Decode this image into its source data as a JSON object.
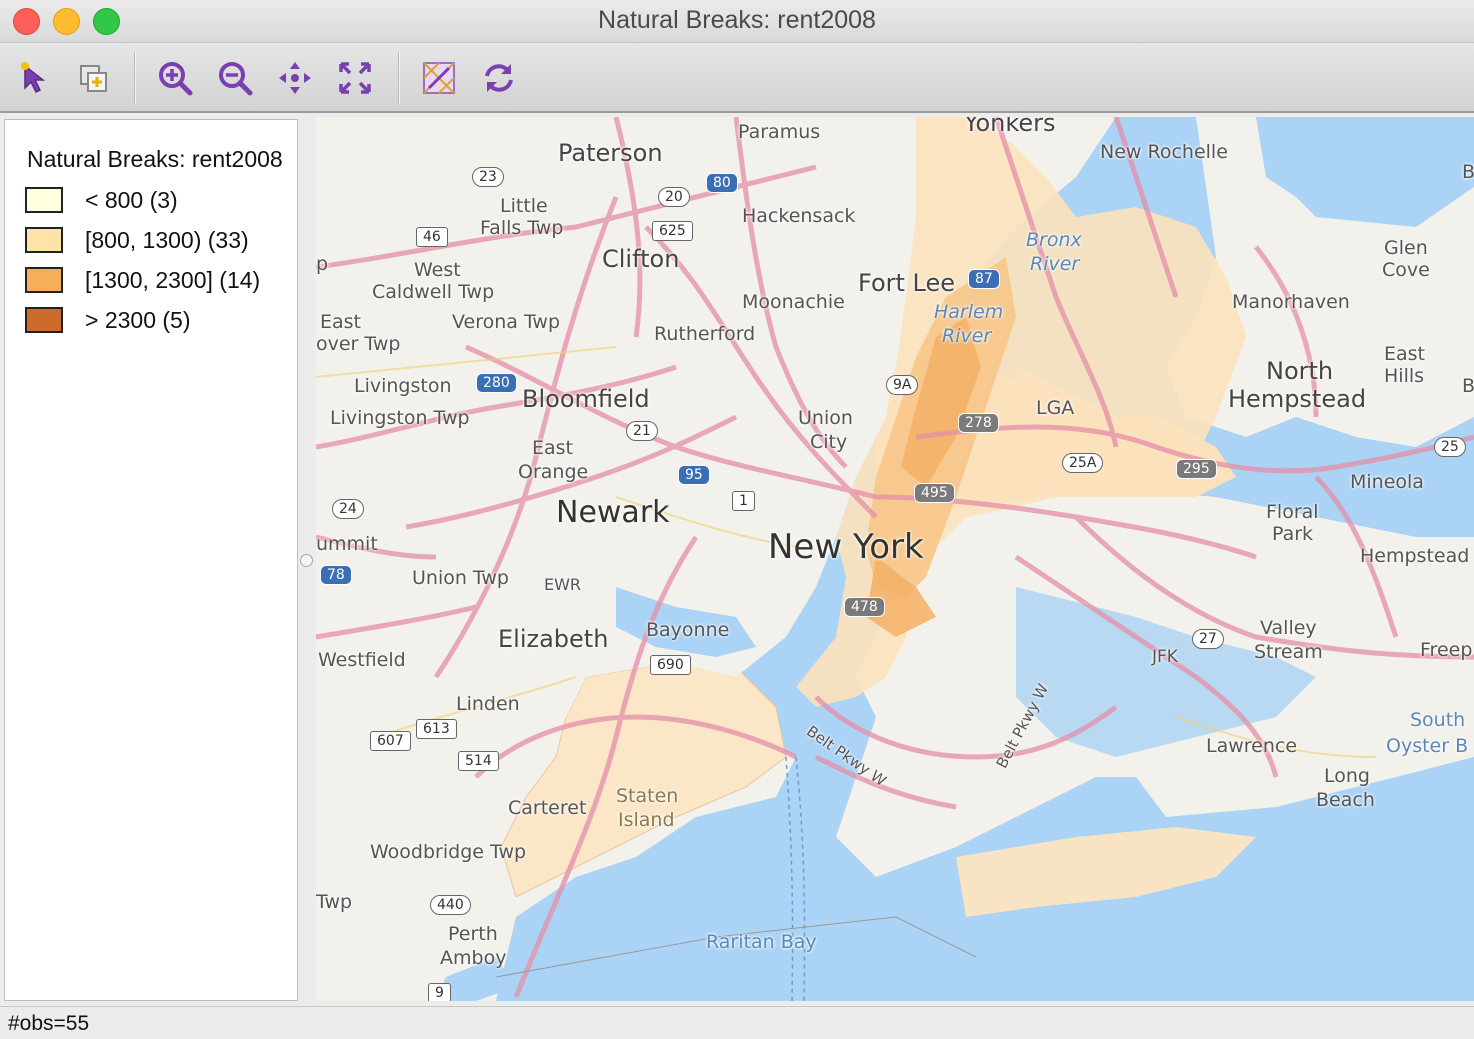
{
  "window": {
    "title": "Natural Breaks: rent2008"
  },
  "toolbar": {
    "tools": [
      {
        "name": "select-icon"
      },
      {
        "name": "copy-icon"
      },
      {
        "name": "zoom-in-icon"
      },
      {
        "name": "zoom-out-icon"
      },
      {
        "name": "pan-icon"
      },
      {
        "name": "full-extent-icon"
      },
      {
        "name": "basemap-icon"
      },
      {
        "name": "refresh-icon"
      }
    ]
  },
  "legend": {
    "title": "Natural Breaks: rent2008",
    "items": [
      {
        "label": "< 800 (3)",
        "color": "#ffffe0"
      },
      {
        "label": "[800, 1300) (33)",
        "color": "#fde3a8"
      },
      {
        "label": "[1300, 2300] (14)",
        "color": "#f6ae5b"
      },
      {
        "label": "> 2300 (5)",
        "color": "#cc6b2c"
      }
    ]
  },
  "map": {
    "labels": {
      "yonkers": "Yonkers",
      "paramus": "Paramus",
      "paterson": "Paterson",
      "new_rochelle": "New Rochelle",
      "little_falls": "Little",
      "little_falls2": "Falls Twp",
      "hackensack": "Hackensack",
      "bronx_river": "Bronx",
      "bronx_river2": "River",
      "glen_cove": "Glen",
      "glen_cove2": "Cove",
      "west_caldwell": "West",
      "west_caldwell2": "Caldwell Twp",
      "clifton": "Clifton",
      "fort_lee": "Fort Lee",
      "moonachie": "Moonachie",
      "harlem_river": "Harlem",
      "harlem_river2": "River",
      "manorhaven": "Manorhaven",
      "east_orange_tw": "East",
      "east_orange_tw2": "over Twp",
      "verona": "Verona Twp",
      "rutherford": "Rutherford",
      "east_hills": "East",
      "east_hills2": "Hills",
      "north_hempstead": "North",
      "north_hempstead2": "Hempstead",
      "livingston": "Livingston",
      "livingston_twp": "Livingston Twp",
      "bloomfield": "Bloomfield",
      "union_city": "Union",
      "union_city2": "City",
      "lga": "LGA",
      "east_orange": "East",
      "east_orange2": "Orange",
      "mineola": "Mineola",
      "floral_park": "Floral",
      "floral_park2": "Park",
      "newark": "Newark",
      "new_york": "New York",
      "hempstead": "Hempstead",
      "summit": "ummit",
      "union_twp": "Union Twp",
      "ewr": "EWR",
      "elizabeth": "Elizabeth",
      "bayonne": "Bayonne",
      "valley_stream": "Valley",
      "valley_stream2": "Stream",
      "westfield": "Westfield",
      "jfk": "JFK",
      "freeport": "Freep",
      "linden": "Linden",
      "south_oyster": "South",
      "south_oyster2": "Oyster B",
      "lawrence": "Lawrence",
      "long_beach": "Long",
      "long_beach2": "Beach",
      "staten_island": "Staten",
      "staten_island2": "Island",
      "carteret": "Carteret",
      "woodbridge": "Woodbridge Twp",
      "twp": "Twp",
      "perth_amboy": "Perth",
      "perth_amboy2": "Amboy",
      "raritan_bay": "Raritan Bay",
      "belt_pkwy_w": "Belt Pkwy W",
      "belt_pkwy": "Belt Pkwy W",
      "edge_p": "p",
      "edge_b": "B",
      "edge_b2": "B"
    },
    "shields": [
      "23",
      "80",
      "20",
      "625",
      "46",
      "87",
      "280",
      "9A",
      "278",
      "21",
      "95",
      "1",
      "495",
      "25A",
      "295",
      "24",
      "78",
      "478",
      "27",
      "690",
      "613",
      "607",
      "514",
      "440",
      "9",
      "25"
    ]
  },
  "status": {
    "text": "#obs=55"
  }
}
